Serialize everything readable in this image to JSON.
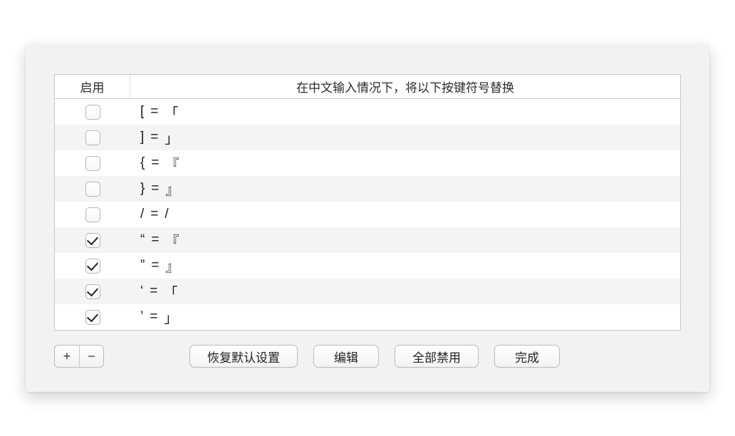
{
  "columns": {
    "enable": "启用",
    "desc": "在中文输入情况下，将以下按键符号替换"
  },
  "rows": [
    {
      "checked": false,
      "from": "[",
      "to": "「"
    },
    {
      "checked": false,
      "from": "]",
      "to": "」"
    },
    {
      "checked": false,
      "from": "{",
      "to": "『"
    },
    {
      "checked": false,
      "from": "}",
      "to": "』"
    },
    {
      "checked": false,
      "from": "/",
      "to": "/"
    },
    {
      "checked": true,
      "from": "“",
      "to": "『"
    },
    {
      "checked": true,
      "from": "”",
      "to": "』"
    },
    {
      "checked": true,
      "from": "‘",
      "to": "「"
    },
    {
      "checked": true,
      "from": "’",
      "to": "」"
    }
  ],
  "buttons": {
    "add": "+",
    "remove": "−",
    "restore_defaults": "恢复默认设置",
    "edit": "编辑",
    "disable_all": "全部禁用",
    "done": "完成"
  },
  "eq": "="
}
